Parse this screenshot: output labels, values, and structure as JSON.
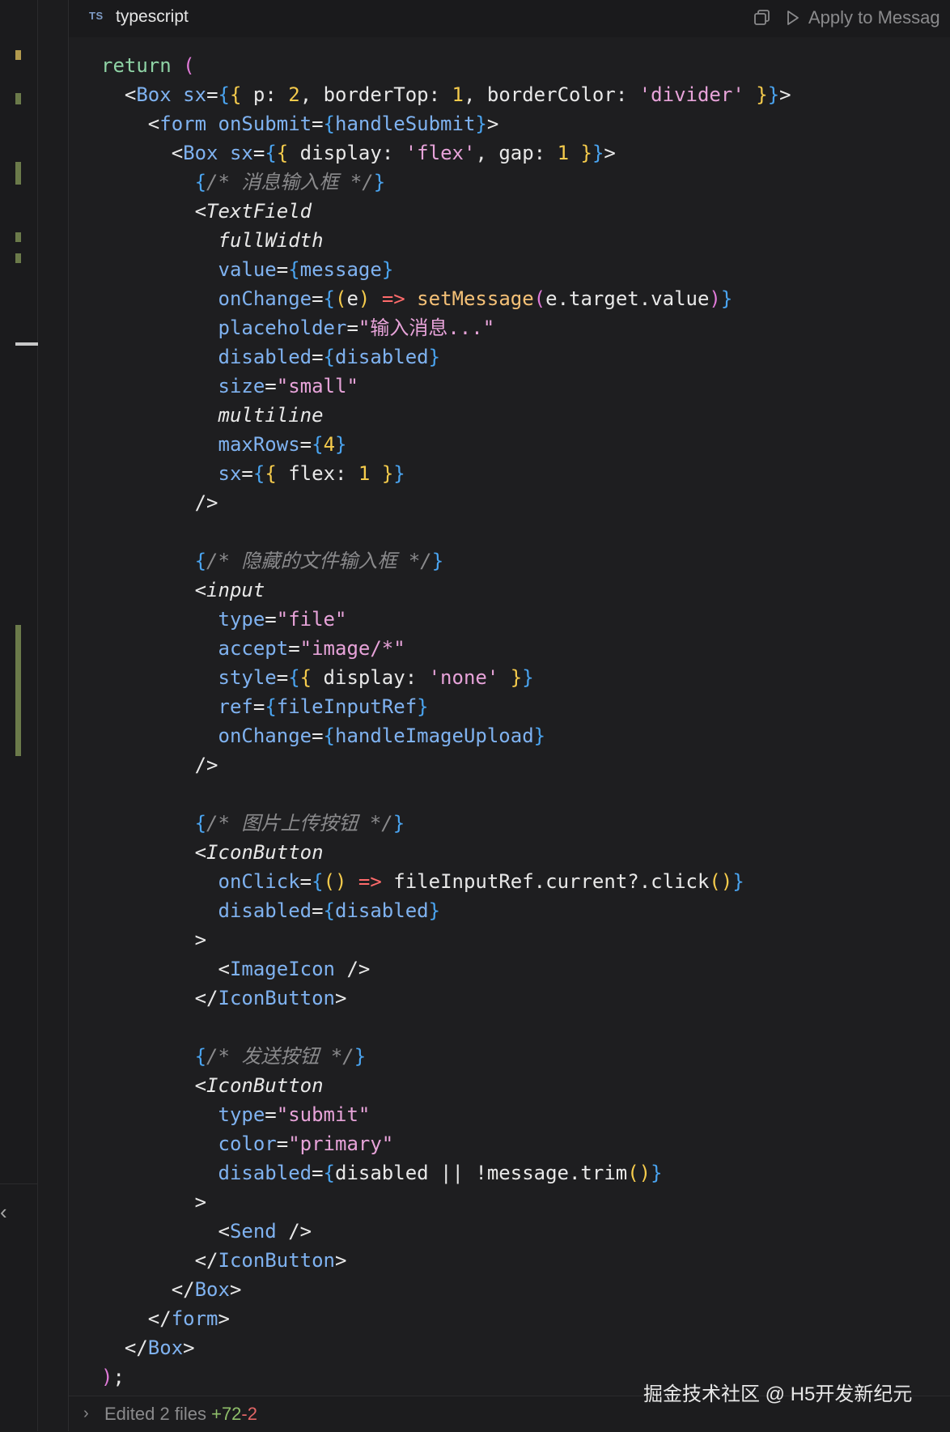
{
  "header": {
    "lang_badge": "TS",
    "lang_label": "typescript",
    "apply_label": "Apply to Messag"
  },
  "code": {
    "lines": [
      [
        [
          "kw",
          "return"
        ],
        [
          "pun",
          " "
        ],
        [
          "br2",
          "("
        ]
      ],
      [
        [
          "pun",
          "  <"
        ],
        [
          "tag",
          "Box"
        ],
        [
          "pun",
          " "
        ],
        [
          "attr",
          "sx"
        ],
        [
          "pun",
          "="
        ],
        [
          "br3",
          "{"
        ],
        [
          "br1",
          "{"
        ],
        [
          "pun",
          " p: "
        ],
        [
          "num",
          "2"
        ],
        [
          "pun",
          ", borderTop: "
        ],
        [
          "num",
          "1"
        ],
        [
          "pun",
          ", borderColor: "
        ],
        [
          "str",
          "'divider'"
        ],
        [
          "pun",
          " "
        ],
        [
          "br1",
          "}"
        ],
        [
          "br3",
          "}"
        ],
        [
          "pun",
          ">"
        ]
      ],
      [
        [
          "pun",
          "    <"
        ],
        [
          "tag",
          "form"
        ],
        [
          "pun",
          " "
        ],
        [
          "attr",
          "onSubmit"
        ],
        [
          "pun",
          "="
        ],
        [
          "br3",
          "{"
        ],
        [
          "tag",
          "handleSubmit"
        ],
        [
          "br3",
          "}"
        ],
        [
          "pun",
          ">"
        ]
      ],
      [
        [
          "pun",
          "      <"
        ],
        [
          "tag",
          "Box"
        ],
        [
          "pun",
          " "
        ],
        [
          "attr",
          "sx"
        ],
        [
          "pun",
          "="
        ],
        [
          "br3",
          "{"
        ],
        [
          "br1",
          "{"
        ],
        [
          "pun",
          " display: "
        ],
        [
          "str",
          "'flex'"
        ],
        [
          "pun",
          ", gap: "
        ],
        [
          "num",
          "1"
        ],
        [
          "pun",
          " "
        ],
        [
          "br1",
          "}"
        ],
        [
          "br3",
          "}"
        ],
        [
          "pun",
          ">"
        ]
      ],
      [
        [
          "pun",
          "        "
        ],
        [
          "br3",
          "{"
        ],
        [
          "cmt",
          "/* 消息输入框 */"
        ],
        [
          "br3",
          "}"
        ]
      ],
      [
        [
          "pun",
          "        <"
        ],
        [
          "tagi",
          "TextField"
        ]
      ],
      [
        [
          "pun",
          "          "
        ],
        [
          "attri",
          "fullWidth"
        ]
      ],
      [
        [
          "pun",
          "          "
        ],
        [
          "attr",
          "value"
        ],
        [
          "pun",
          "="
        ],
        [
          "br3",
          "{"
        ],
        [
          "tag",
          "message"
        ],
        [
          "br3",
          "}"
        ]
      ],
      [
        [
          "pun",
          "          "
        ],
        [
          "attr",
          "onChange"
        ],
        [
          "pun",
          "="
        ],
        [
          "br3",
          "{"
        ],
        [
          "br1",
          "("
        ],
        [
          "txt",
          "e"
        ],
        [
          "br1",
          ")"
        ],
        [
          "pun",
          " "
        ],
        [
          "arrow",
          "=>"
        ],
        [
          "pun",
          " "
        ],
        [
          "fn",
          "setMessage"
        ],
        [
          "br2",
          "("
        ],
        [
          "txt",
          "e.target.value"
        ],
        [
          "br2",
          ")"
        ],
        [
          "br3",
          "}"
        ]
      ],
      [
        [
          "pun",
          "          "
        ],
        [
          "attr",
          "placeholder"
        ],
        [
          "pun",
          "="
        ],
        [
          "str",
          "\"输入消息...\""
        ]
      ],
      [
        [
          "pun",
          "          "
        ],
        [
          "attr",
          "disabled"
        ],
        [
          "pun",
          "="
        ],
        [
          "br3",
          "{"
        ],
        [
          "tag",
          "disabled"
        ],
        [
          "br3",
          "}"
        ]
      ],
      [
        [
          "pun",
          "          "
        ],
        [
          "attr",
          "size"
        ],
        [
          "pun",
          "="
        ],
        [
          "str",
          "\"small\""
        ]
      ],
      [
        [
          "pun",
          "          "
        ],
        [
          "attri",
          "multiline"
        ]
      ],
      [
        [
          "pun",
          "          "
        ],
        [
          "attr",
          "maxRows"
        ],
        [
          "pun",
          "="
        ],
        [
          "br3",
          "{"
        ],
        [
          "num",
          "4"
        ],
        [
          "br3",
          "}"
        ]
      ],
      [
        [
          "pun",
          "          "
        ],
        [
          "attr",
          "sx"
        ],
        [
          "pun",
          "="
        ],
        [
          "br3",
          "{"
        ],
        [
          "br1",
          "{"
        ],
        [
          "pun",
          " flex: "
        ],
        [
          "num",
          "1"
        ],
        [
          "pun",
          " "
        ],
        [
          "br1",
          "}"
        ],
        [
          "br3",
          "}"
        ]
      ],
      [
        [
          "pun",
          "        />"
        ]
      ],
      [
        [
          "pun",
          ""
        ]
      ],
      [
        [
          "pun",
          "        "
        ],
        [
          "br3",
          "{"
        ],
        [
          "cmt",
          "/* 隐藏的文件输入框 */"
        ],
        [
          "br3",
          "}"
        ]
      ],
      [
        [
          "pun",
          "        <"
        ],
        [
          "tagi",
          "input"
        ]
      ],
      [
        [
          "pun",
          "          "
        ],
        [
          "attr",
          "type"
        ],
        [
          "pun",
          "="
        ],
        [
          "str",
          "\"file\""
        ]
      ],
      [
        [
          "pun",
          "          "
        ],
        [
          "attr",
          "accept"
        ],
        [
          "pun",
          "="
        ],
        [
          "str",
          "\"image/*\""
        ]
      ],
      [
        [
          "pun",
          "          "
        ],
        [
          "attr",
          "style"
        ],
        [
          "pun",
          "="
        ],
        [
          "br3",
          "{"
        ],
        [
          "br1",
          "{"
        ],
        [
          "pun",
          " display: "
        ],
        [
          "str",
          "'none'"
        ],
        [
          "pun",
          " "
        ],
        [
          "br1",
          "}"
        ],
        [
          "br3",
          "}"
        ]
      ],
      [
        [
          "pun",
          "          "
        ],
        [
          "attr",
          "ref"
        ],
        [
          "pun",
          "="
        ],
        [
          "br3",
          "{"
        ],
        [
          "tag",
          "fileInputRef"
        ],
        [
          "br3",
          "}"
        ]
      ],
      [
        [
          "pun",
          "          "
        ],
        [
          "attr",
          "onChange"
        ],
        [
          "pun",
          "="
        ],
        [
          "br3",
          "{"
        ],
        [
          "tag",
          "handleImageUpload"
        ],
        [
          "br3",
          "}"
        ]
      ],
      [
        [
          "pun",
          "        />"
        ]
      ],
      [
        [
          "pun",
          ""
        ]
      ],
      [
        [
          "pun",
          "        "
        ],
        [
          "br3",
          "{"
        ],
        [
          "cmt",
          "/* 图片上传按钮 */"
        ],
        [
          "br3",
          "}"
        ]
      ],
      [
        [
          "pun",
          "        <"
        ],
        [
          "tagi",
          "IconButton"
        ]
      ],
      [
        [
          "pun",
          "          "
        ],
        [
          "attr",
          "onClick"
        ],
        [
          "pun",
          "="
        ],
        [
          "br3",
          "{"
        ],
        [
          "br1",
          "()"
        ],
        [
          "pun",
          " "
        ],
        [
          "arrow",
          "=>"
        ],
        [
          "pun",
          " "
        ],
        [
          "txt",
          "fileInputRef.current?.click"
        ],
        [
          "br1",
          "()"
        ],
        [
          "br3",
          "}"
        ]
      ],
      [
        [
          "pun",
          "          "
        ],
        [
          "attr",
          "disabled"
        ],
        [
          "pun",
          "="
        ],
        [
          "br3",
          "{"
        ],
        [
          "tag",
          "disabled"
        ],
        [
          "br3",
          "}"
        ]
      ],
      [
        [
          "pun",
          "        >"
        ]
      ],
      [
        [
          "pun",
          "          <"
        ],
        [
          "tag",
          "ImageIcon"
        ],
        [
          "pun",
          " />"
        ]
      ],
      [
        [
          "pun",
          "        </"
        ],
        [
          "tag",
          "IconButton"
        ],
        [
          "pun",
          ">"
        ]
      ],
      [
        [
          "pun",
          ""
        ]
      ],
      [
        [
          "pun",
          "        "
        ],
        [
          "br3",
          "{"
        ],
        [
          "cmt",
          "/* 发送按钮 */"
        ],
        [
          "br3",
          "}"
        ]
      ],
      [
        [
          "pun",
          "        <"
        ],
        [
          "tagi",
          "IconButton"
        ]
      ],
      [
        [
          "pun",
          "          "
        ],
        [
          "attr",
          "type"
        ],
        [
          "pun",
          "="
        ],
        [
          "str",
          "\"submit\""
        ]
      ],
      [
        [
          "pun",
          "          "
        ],
        [
          "attr",
          "color"
        ],
        [
          "pun",
          "="
        ],
        [
          "str",
          "\"primary\""
        ]
      ],
      [
        [
          "pun",
          "          "
        ],
        [
          "attr",
          "disabled"
        ],
        [
          "pun",
          "="
        ],
        [
          "br3",
          "{"
        ],
        [
          "txt",
          "disabled || !message.trim"
        ],
        [
          "br1",
          "()"
        ],
        [
          "br3",
          "}"
        ]
      ],
      [
        [
          "pun",
          "        >"
        ]
      ],
      [
        [
          "pun",
          "          <"
        ],
        [
          "tag",
          "Send"
        ],
        [
          "pun",
          " />"
        ]
      ],
      [
        [
          "pun",
          "        </"
        ],
        [
          "tag",
          "IconButton"
        ],
        [
          "pun",
          ">"
        ]
      ],
      [
        [
          "pun",
          "      </"
        ],
        [
          "tag",
          "Box"
        ],
        [
          "pun",
          ">"
        ]
      ],
      [
        [
          "pun",
          "    </"
        ],
        [
          "tag",
          "form"
        ],
        [
          "pun",
          ">"
        ]
      ],
      [
        [
          "pun",
          "  </"
        ],
        [
          "tag",
          "Box"
        ],
        [
          "pun",
          ">"
        ]
      ],
      [
        [
          "br2",
          ")"
        ],
        [
          "pun",
          ";"
        ]
      ]
    ]
  },
  "footer": {
    "edited_label": "Edited 2 files",
    "additions": "+72",
    "deletions": "-2"
  },
  "watermark": "掘金技术社区 @ H5开发新纪元",
  "colors": {
    "background": "#1e1e20",
    "keyword": "#8fd3a5",
    "tag": "#7fb2f0",
    "string": "#e7a3d9",
    "number": "#f5cb4c",
    "comment": "#8a8a8c",
    "added": "#8fbf6a",
    "deleted": "#e26666"
  },
  "icons": [
    "copy-icon",
    "play-icon",
    "chevron-right-icon",
    "chevron-left-icon"
  ]
}
